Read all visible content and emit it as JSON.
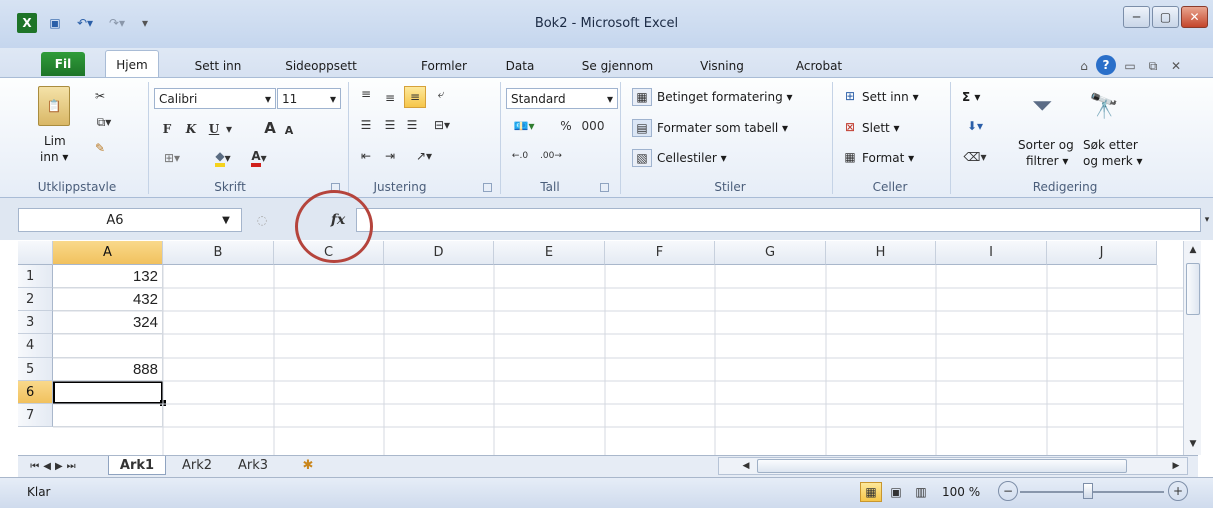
{
  "window": {
    "title": "Bok2 - Microsoft Excel"
  },
  "tabs": [
    "Fil",
    "Hjem",
    "Sett inn",
    "Sideoppsett",
    "Formler",
    "Data",
    "Se gjennom",
    "Visning",
    "Acrobat"
  ],
  "ribbon": {
    "clipboard": {
      "paste_label_1": "Lim",
      "paste_label_2": "inn ▾",
      "group": "Utklippstavle"
    },
    "font": {
      "name": "Calibri",
      "size": "11",
      "bold": "F",
      "italic": "K",
      "underline": "U",
      "grow": "A",
      "shrink": "A",
      "group": "Skrift"
    },
    "alignment": {
      "group": "Justering"
    },
    "number": {
      "format": "Standard",
      "percent": "%",
      "thousands": "000",
      "group": "Tall"
    },
    "styles": {
      "conditional": "Betinget formatering ▾",
      "as_table": "Formater som tabell ▾",
      "cell_styles": "Cellestiler ▾",
      "group": "Stiler"
    },
    "cells": {
      "insert": "Sett inn ▾",
      "delete": "Slett ▾",
      "format": "Format ▾",
      "group": "Celler"
    },
    "editing": {
      "sigma": "Σ ▾",
      "sort_1": "Sorter og",
      "sort_2": "filtrer ▾",
      "find_1": "Søk etter",
      "find_2": "og merk ▾",
      "group": "Redigering"
    }
  },
  "formula_bar": {
    "name_box": "A6",
    "fx": "fx",
    "content": ""
  },
  "grid": {
    "columns": [
      "A",
      "B",
      "C",
      "D",
      "E",
      "F",
      "G",
      "H",
      "I",
      "J"
    ],
    "rows": [
      "1",
      "2",
      "3",
      "4",
      "5",
      "6",
      "7"
    ],
    "cells_A": [
      "132",
      "432",
      "324",
      "",
      "888",
      "",
      ""
    ],
    "selected_cell": "A6"
  },
  "sheets": [
    "Ark1",
    "Ark2",
    "Ark3"
  ],
  "status": {
    "ready": "Klar",
    "zoom": "100 %"
  },
  "colors": {
    "accent_green": "#1e7428",
    "selected_header": "#f1c15e",
    "annotation_circle": "#b5443c"
  }
}
